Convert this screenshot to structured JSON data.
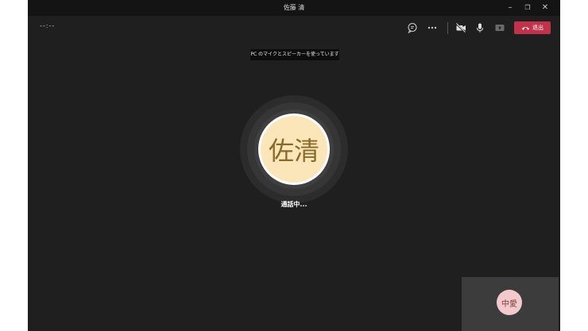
{
  "window": {
    "title": "佐藤 清",
    "controls": {
      "minimize": "–",
      "maximize": "❐",
      "close": "✕"
    }
  },
  "toolbar": {
    "timer": "--:--",
    "chat_icon": "chat-icon",
    "more_icon": "more-options-icon",
    "camera_icon": "camera-off-icon",
    "mic_icon": "microphone-icon",
    "share_icon": "share-screen-icon",
    "leave_label": "退出",
    "leave_color": "#c4314b"
  },
  "banner": {
    "text": "PC のマイクとスピーカーを使っています"
  },
  "callee": {
    "initials": "佐清",
    "status": "通話中...",
    "avatar_color": "#fbe6ba"
  },
  "self_view": {
    "initials": "中愛",
    "avatar_color": "#f2c9cc"
  }
}
